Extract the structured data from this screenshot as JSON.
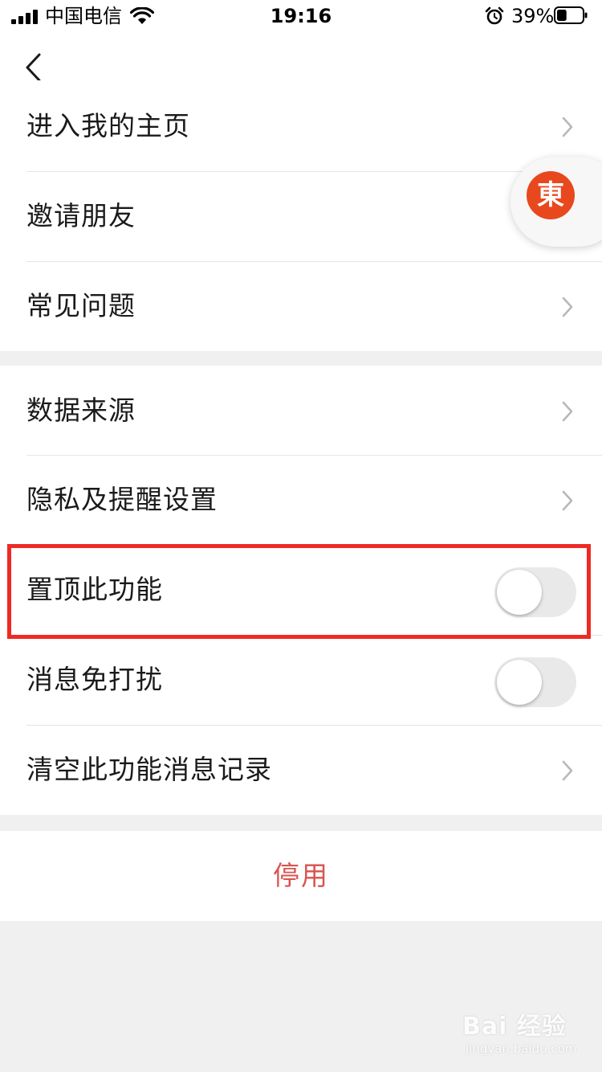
{
  "status_bar": {
    "carrier": "中国电信",
    "time": "19:16",
    "battery_percent": "39%",
    "battery_level": 0.39
  },
  "nav": {
    "back_icon": "chevron-left-icon"
  },
  "groups": [
    {
      "items": [
        {
          "label": "进入我的主页",
          "control": "chevron"
        },
        {
          "label": "邀请朋友",
          "control": "chevron"
        },
        {
          "label": "常见问题",
          "control": "chevron"
        }
      ]
    },
    {
      "items": [
        {
          "label": "数据来源",
          "control": "chevron"
        },
        {
          "label": "隐私及提醒设置",
          "control": "chevron"
        },
        {
          "label": "置顶此功能",
          "control": "toggle",
          "on": false
        },
        {
          "label": "消息免打扰",
          "control": "toggle",
          "on": false
        },
        {
          "label": "清空此功能消息记录",
          "control": "chevron"
        }
      ]
    }
  ],
  "disable_button": {
    "label": "停用"
  },
  "floating_widget": {
    "logo_text": "東"
  },
  "watermark": {
    "main": "Bai 经验",
    "sub": "jingyan.baidu.com"
  },
  "colors": {
    "destructive": "#d9534f",
    "highlight_border": "#ee2a24",
    "logo": "#e8481d",
    "toggle_off": "#e9e9ea"
  }
}
